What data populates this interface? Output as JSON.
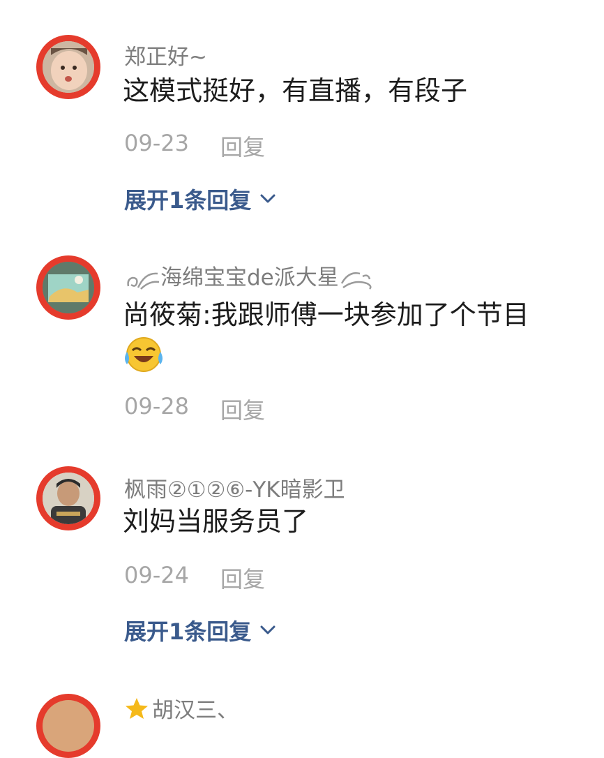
{
  "comments": [
    {
      "username": "郑正好~",
      "text": "这模式挺好，有直播，有段子",
      "date": "09-23",
      "reply_label": "回复",
      "expand_label": "展开1条回复"
    },
    {
      "username": "海绵宝宝de派大星",
      "text": "尚筱菊:我跟师傅一块参加了个节目",
      "emoji": "😂",
      "date": "09-28",
      "reply_label": "回复"
    },
    {
      "username": "枫雨②①②⑥-YK暗影卫",
      "text": "刘妈当服务员了",
      "date": "09-24",
      "reply_label": "回复",
      "expand_label": "展开1条回复"
    },
    {
      "username": "胡汉三、",
      "badge_icon": "star-icon"
    }
  ],
  "colors": {
    "avatar_ring": "#e53b2c",
    "expand_link": "#3a5a8c",
    "username": "#7d7d7d",
    "meta": "#a6a6a6"
  }
}
